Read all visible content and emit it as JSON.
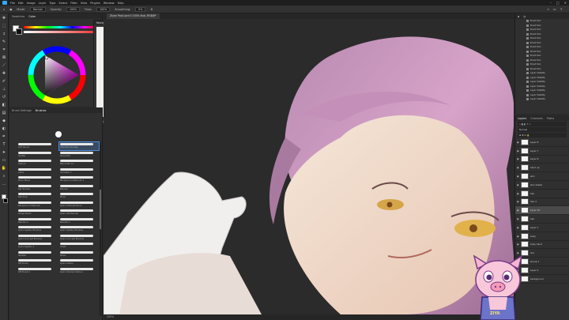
{
  "menubar": {
    "items": [
      "File",
      "Edit",
      "Image",
      "Layer",
      "Type",
      "Select",
      "Filter",
      "View",
      "Plugins",
      "Window",
      "Help"
    ],
    "controls": [
      "–",
      "□",
      "✕"
    ]
  },
  "optionsbar": {
    "mode_label": "Mode:",
    "mode_value": "Normal",
    "opacity_label": "Opacity:",
    "opacity_value": "100%",
    "flow_label": "Flow:",
    "flow_value": "100%",
    "smoothing_label": "Smoothing:",
    "smoothing_value": "0%"
  },
  "color_panel": {
    "tabs": [
      "Swatches",
      "Color"
    ],
    "foreground": "#ffffff",
    "background": "#111111"
  },
  "navigator": {
    "title": "Navigator",
    "zoom": "200%"
  },
  "canvas": {
    "doc_tab": "Ziyan Pool Lord 0 100% Bud, RGB/8*"
  },
  "statusbar": {
    "zoom": "200%"
  },
  "brush_panel": {
    "tabs": [
      "Brush Settings",
      "Brushes"
    ],
    "brushes": [
      [
        "Soft Round",
        "Ultimate Smudge"
      ],
      [
        "Spatter",
        "Sharp Mix"
      ],
      [
        "Texture",
        "Blend Stk 1.1"
      ],
      [
        "Lasso",
        "Inkmaker 1"
      ],
      [
        "Mixer Blend",
        "Background Stkbrush 2"
      ],
      [
        "Big Shadow",
        "Blender"
      ],
      [
        "Blending",
        "Mixer"
      ],
      [
        "Background Stkbrush",
        "Kyle's Ultimate Pencil"
      ],
      [
        "Shape Brush",
        "Kyle's Stk Blender"
      ],
      [
        "Blender 4",
        "Blender 5"
      ],
      [
        "Kyle's Spatter Brushes",
        "Kyle's Spatter Brushes"
      ],
      [
        "Kyle's Concept Brushes",
        "Kyle's Concept Brushes"
      ],
      [
        "Kyle's Spatter 1",
        "Chalk"
      ],
      [
        "Splatter",
        "Noise"
      ],
      [
        "DM Brush",
        "Kyle's Inkbox"
      ],
      [
        "DM Brush 2",
        "Kyle's Shadow Texture"
      ]
    ]
  },
  "history": {
    "items": [
      "Brush Tool",
      "Brush Tool",
      "Brush Tool",
      "Brush Tool",
      "Brush Tool",
      "Brush Tool",
      "Brush Tool",
      "Brush Tool",
      "Brush Tool",
      "Brush Tool",
      "Brush Tool",
      "Brush Tool",
      "Layer Visibility",
      "Layer Visibility",
      "Layer Visibility",
      "Layer Visibility",
      "Layer Visibility",
      "Layer Visibility",
      "Layer Visibility"
    ]
  },
  "layers": {
    "tabs": [
      "Layers",
      "Channels",
      "Paths"
    ],
    "blend_mode": "Normal",
    "layer_list": [
      "Layer 8",
      "Layer 7",
      "Layer 6",
      "hand up",
      "skin",
      "skin shade",
      "hair",
      "hair 2",
      "Layer 10",
      "hair",
      "Layer 7",
      "body",
      "body hand",
      "line",
      "Group 1",
      "Layer 2",
      "background"
    ]
  },
  "mascot": {
    "label": "ZIYA"
  }
}
